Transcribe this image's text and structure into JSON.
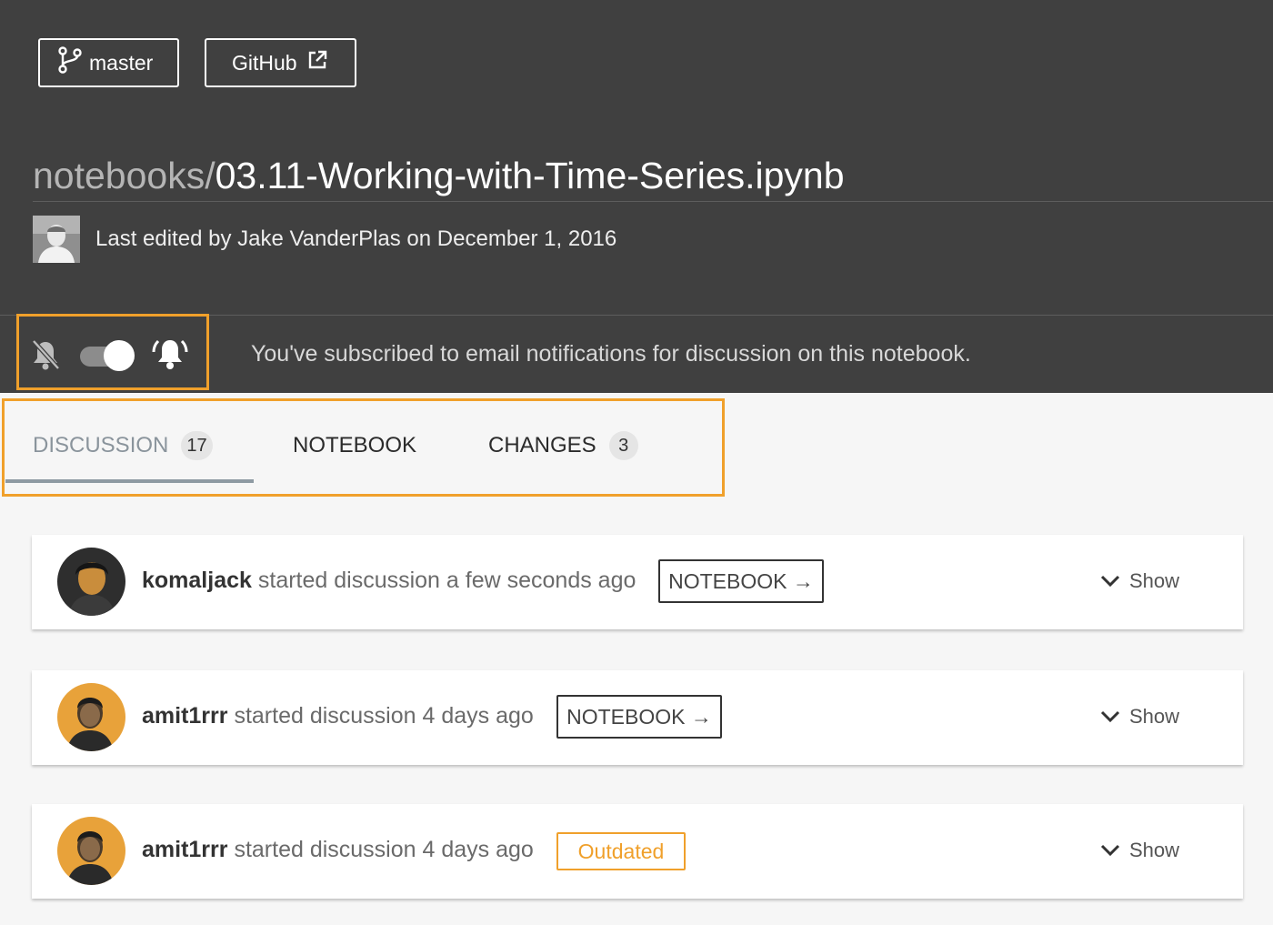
{
  "header": {
    "branch_label": "master",
    "github_label": "GitHub",
    "path_dir": "notebooks/",
    "path_file": "03.11-Working-with-Time-Series.ipynb",
    "last_edited": "Last edited by Jake VanderPlas on December 1, 2016"
  },
  "notifications": {
    "enabled": true,
    "message": "You've subscribed to email notifications for discussion on this notebook."
  },
  "tabs": [
    {
      "label": "DISCUSSION",
      "count": "17",
      "active": true
    },
    {
      "label": "NOTEBOOK",
      "count": null,
      "active": false
    },
    {
      "label": "CHANGES",
      "count": "3",
      "active": false
    }
  ],
  "discussions": [
    {
      "user": "komaljack",
      "text": " started discussion a few seconds ago",
      "tag": "NOTEBOOK →",
      "show": "Show"
    },
    {
      "user": "amit1rrr",
      "text": " started discussion 4 days ago",
      "tag": "NOTEBOOK →",
      "show": "Show"
    },
    {
      "user": "amit1rrr",
      "text": " started discussion 4 days ago",
      "tag": "Outdated",
      "show": "Show"
    }
  ],
  "colors": {
    "header_bg": "#404040",
    "accent_highlight": "#f0a02b",
    "outdated": "#f0a02b",
    "avatar_orange": "#e8a23a"
  },
  "icons": [
    "git-branch-icon",
    "external-link-icon",
    "bell-off-icon",
    "bell-ring-icon",
    "chevron-down-icon"
  ]
}
